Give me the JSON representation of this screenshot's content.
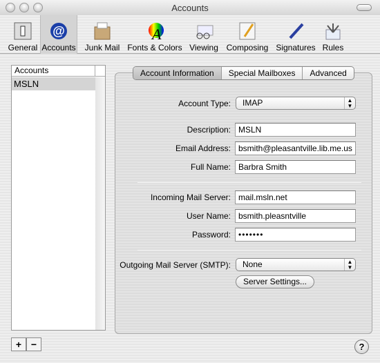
{
  "window": {
    "title": "Accounts"
  },
  "toolbar": {
    "items": [
      {
        "label": "General",
        "icon": "switch-icon"
      },
      {
        "label": "Accounts",
        "icon": "at-icon",
        "selected": true
      },
      {
        "label": "Junk Mail",
        "icon": "junk-box-icon"
      },
      {
        "label": "Fonts & Colors",
        "icon": "font-color-wheel-icon"
      },
      {
        "label": "Viewing",
        "icon": "glasses-icon"
      },
      {
        "label": "Composing",
        "icon": "pencil-paper-icon"
      },
      {
        "label": "Signatures",
        "icon": "pen-icon"
      },
      {
        "label": "Rules",
        "icon": "rules-arrows-icon"
      }
    ]
  },
  "accounts_list": {
    "header": "Accounts",
    "items": [
      "MSLN"
    ],
    "add_label": "+",
    "remove_label": "−"
  },
  "tabs": [
    "Account Information",
    "Special Mailboxes",
    "Advanced"
  ],
  "form": {
    "account_type": {
      "label": "Account Type:",
      "value": "IMAP"
    },
    "description": {
      "label": "Description:",
      "value": "MSLN"
    },
    "email": {
      "label": "Email Address:",
      "value": "bsmith@pleasantville.lib.me.us"
    },
    "full_name": {
      "label": "Full Name:",
      "value": "Barbra Smith"
    },
    "incoming": {
      "label": "Incoming Mail Server:",
      "value": "mail.msln.net"
    },
    "user_name": {
      "label": "User Name:",
      "value": "bsmith.pleasntville"
    },
    "password": {
      "label": "Password:",
      "value": "•••••••"
    },
    "outgoing": {
      "label": "Outgoing Mail Server (SMTP):",
      "value": "None"
    },
    "server_settings": "Server Settings..."
  },
  "help": "?"
}
